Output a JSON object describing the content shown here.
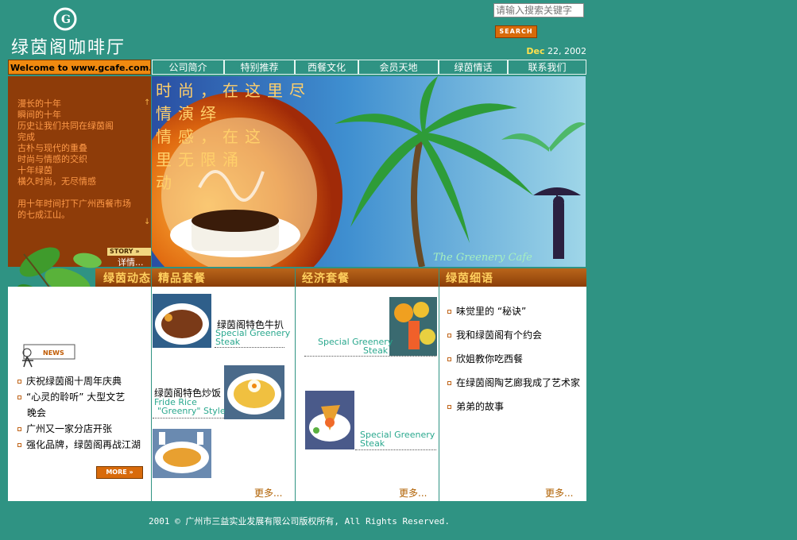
{
  "logo": {
    "mark": "G",
    "name": "绿茵阁咖啡厅"
  },
  "search": {
    "placeholder": "请输入搜索关键字",
    "button_label": "SEARCH"
  },
  "date": {
    "month": "Dec",
    "rest": "22, 2002"
  },
  "welcome": "Welcome to www.gcafe.com.cn",
  "nav": [
    {
      "label": "公司简介"
    },
    {
      "label": "特别推荐"
    },
    {
      "label": "西餐文化"
    },
    {
      "label": "会员天地"
    },
    {
      "label": "绿茵情话"
    },
    {
      "label": "联系我们"
    }
  ],
  "story": {
    "lines": [
      "漫长的十年",
      "瞬间的十年",
      "历史让我们共同在绿茵阁",
      "完成",
      "古朴与现代的重叠",
      "时尚与情感的交织",
      "十年绿茵",
      "橫久时尚，无尽情感",
      "",
      "用十年时间打下广州西餐市场",
      "的七成江山。"
    ],
    "tag": "STORY »",
    "more": "详情..."
  },
  "banner": {
    "text_lines": [
      "时尚，在这里尽",
      "情演绎",
      "情感，在这",
      "里无限涌",
      "动"
    ],
    "caption": "The Greenery Cafe"
  },
  "sections": {
    "news": {
      "title": "绿茵动态",
      "badge": "NEWS",
      "items": [
        "庆祝绿茵阁十周年庆典",
        "“心灵的聆听” 大型文艺",
        "晚会",
        "广州又一家分店开张",
        "强化品牌，绿茵阁再战江湖"
      ],
      "more": "MORE »"
    },
    "premium": {
      "title": "精品套餐",
      "dishes": [
        {
          "title": "绿茵阁特色牛扒",
          "sub1": "Special Greenery",
          "sub2": "Steak"
        },
        {
          "title": "绿茵阁特色炒饭",
          "sub1": "Fride Rice",
          "sub2": "\"Greenry\" Style"
        }
      ],
      "more": "更多..."
    },
    "economy": {
      "title": "经济套餐",
      "dishes": [
        {
          "sub1": "Special Greenery",
          "sub2": "Steak"
        },
        {
          "sub1": "Special Greenery",
          "sub2": "Steak"
        }
      ],
      "more": "更多..."
    },
    "whisper": {
      "title": "绿茵细语",
      "items": [
        "味觉里的 “秘诀”",
        "我和绿茵阁有个约会",
        "欣姐教你吃西餐",
        "在绿茵阁陶艺廊我成了艺术家",
        "弟弟的故事"
      ],
      "more": "更多..."
    }
  },
  "footer": "2001 © 广州市三益实业发展有限公司版权所有, All Rights Reserved.",
  "colors": {
    "bg": "#2f9383",
    "accent": "#f08a10",
    "story_bg": "#8e3c09"
  }
}
